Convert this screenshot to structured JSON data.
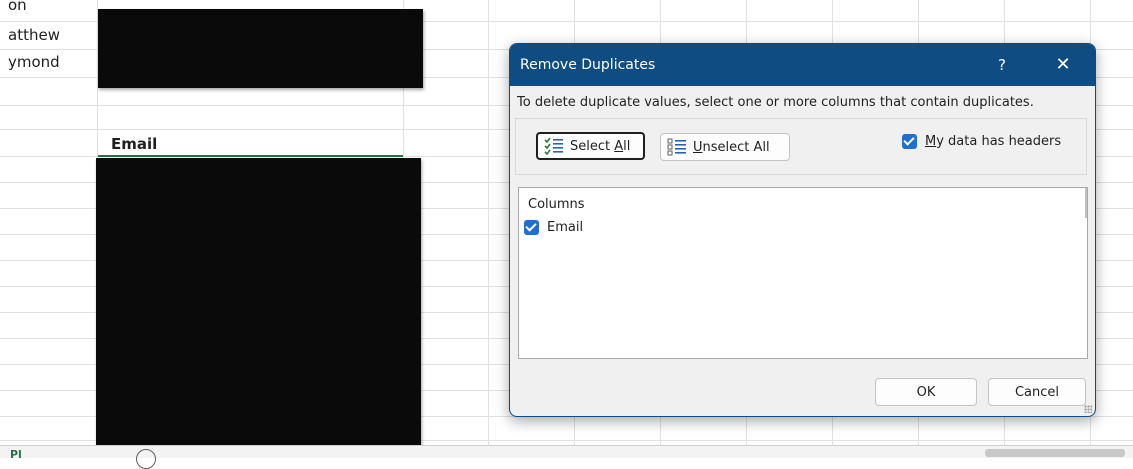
{
  "sheet": {
    "visible_names": [
      "on",
      "atthew",
      "ymond"
    ],
    "header_cell": "Email",
    "tab_label": "Pl"
  },
  "dialog": {
    "title": "Remove Duplicates",
    "help_label": "?",
    "close_label": "✕",
    "instructions": "To delete duplicate values, select one or more columns that contain duplicates.",
    "select_all": {
      "prefix": "Select ",
      "accel": "A",
      "suffix": "ll",
      "icon": "select-all-icon"
    },
    "unselect_all": {
      "accel": "U",
      "suffix": "nselect All",
      "icon": "unselect-all-icon"
    },
    "headers_checkbox": {
      "accel": "M",
      "suffix": "y data has headers",
      "checked": true
    },
    "columns_header": "Columns",
    "columns": [
      {
        "label": "Email",
        "checked": true
      }
    ],
    "ok_label": "OK",
    "cancel_label": "Cancel"
  },
  "colors": {
    "title_bar": "#0f4c81",
    "checkbox": "#1e6fd0",
    "excel_green": "#217346"
  }
}
